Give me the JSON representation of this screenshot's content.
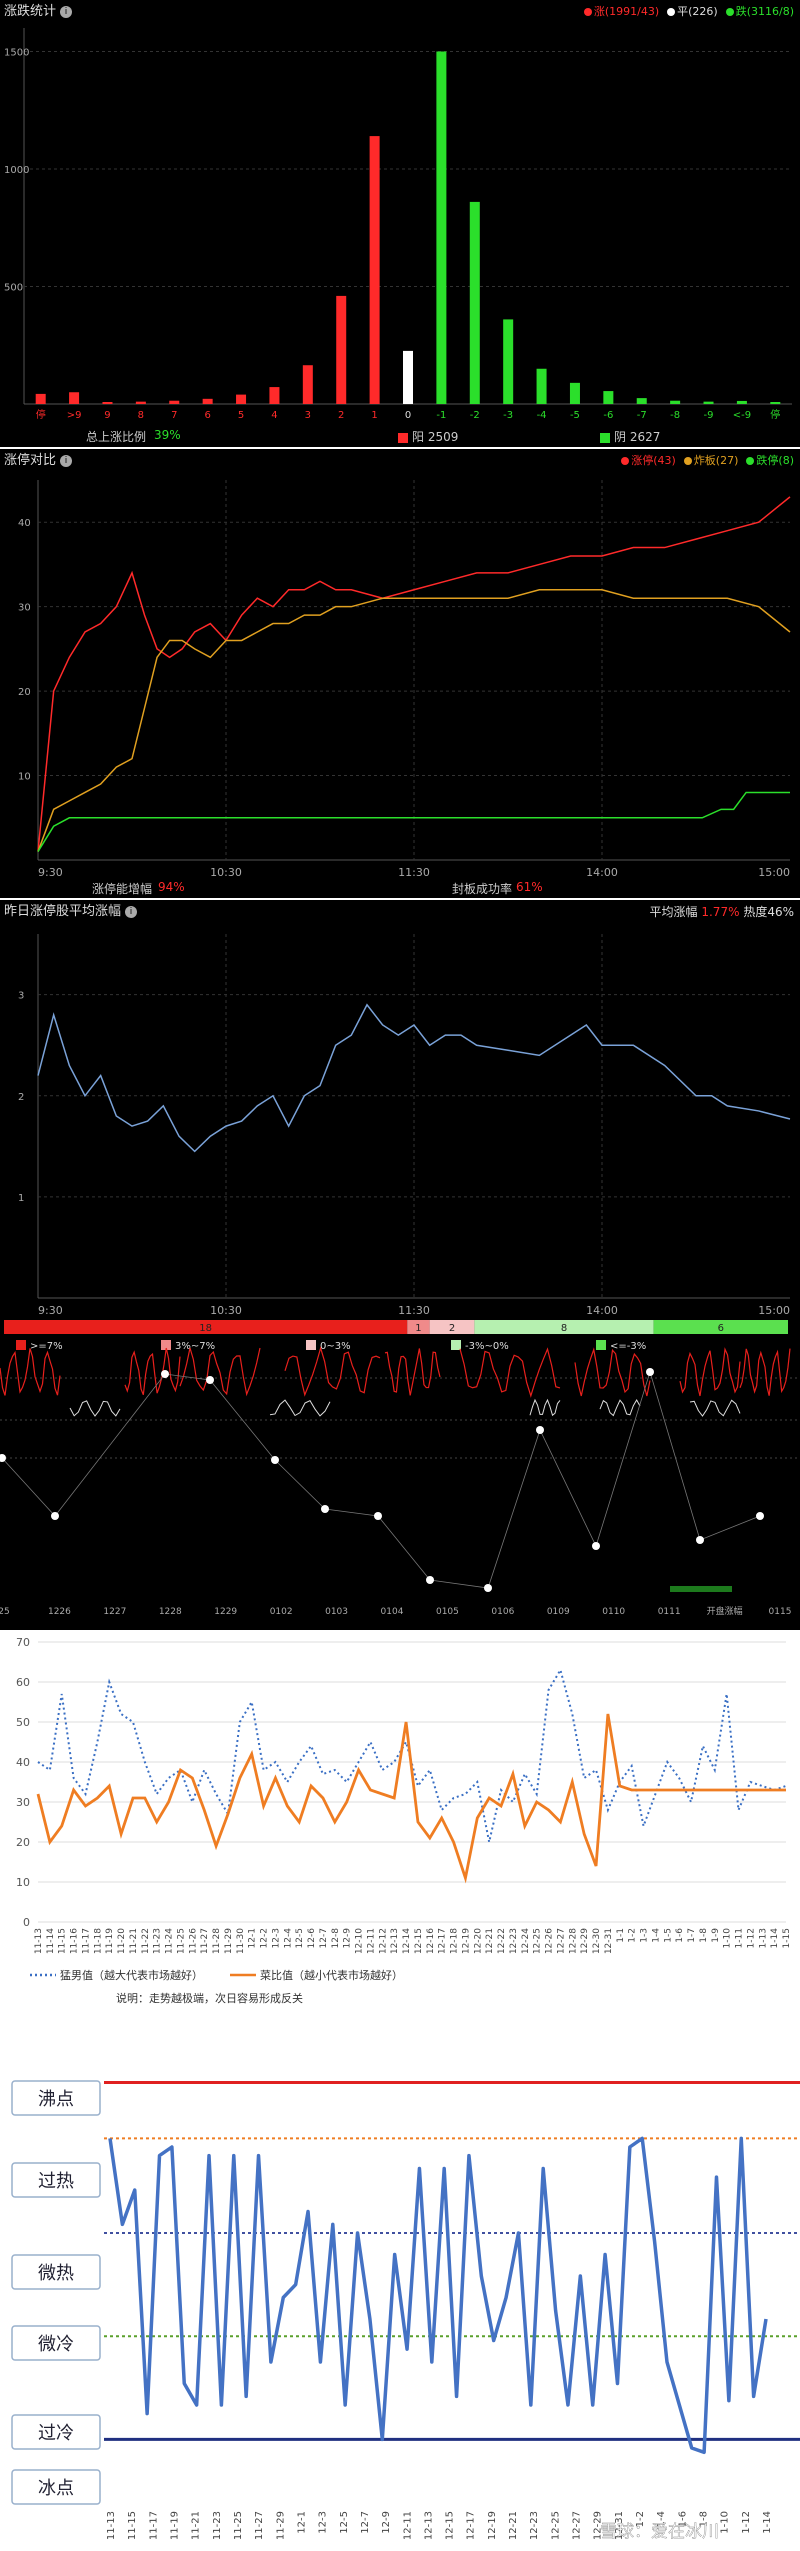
{
  "panel1": {
    "title": "涨跌统计",
    "legend": [
      {
        "label": "涨(1991/43)",
        "color": "#ff2a2a"
      },
      {
        "label": "平(226)",
        "color": "#ffffff"
      },
      {
        "label": "跌(3116/8)",
        "color": "#2bdf2b"
      }
    ],
    "footer": {
      "ratio_label": "总上涨比例",
      "ratio_value": "39%",
      "up_label": "阳 2509",
      "down_label": "阴 2627"
    }
  },
  "panel2": {
    "title": "涨停对比",
    "legend": [
      {
        "label": "涨停(43)",
        "color": "#ff2a2a"
      },
      {
        "label": "炸板(27)",
        "color": "#e0a020"
      },
      {
        "label": "跌停(8)",
        "color": "#2bdf2b"
      }
    ],
    "footer": {
      "a_label": "涨停能增幅",
      "a_value": "94%",
      "b_label": "封板成功率",
      "b_value": "61%"
    }
  },
  "panel3": {
    "title": "昨日涨停股平均涨幅",
    "right_label": "平均涨幅",
    "right_value": "1.77%",
    "heat_label": "热度46%"
  },
  "panel4": {
    "bar_segments": [
      {
        "label": "18",
        "value": 18,
        "color": "#e8201c"
      },
      {
        "label": "1",
        "value": 1,
        "color": "#f08a8a"
      },
      {
        "label": "2",
        "value": 2,
        "color": "#f6c4c4"
      },
      {
        "label": "8",
        "value": 8,
        "color": "#b6f0b0"
      },
      {
        "label": "6",
        "value": 6,
        "color": "#5be04f"
      }
    ],
    "legend": [
      {
        "label": ">=7%",
        "color": "#e8201c"
      },
      {
        "label": "3%~7%",
        "color": "#f08a8a"
      },
      {
        "label": "0~3%",
        "color": "#f6c4c4"
      },
      {
        "label": "-3%~0%",
        "color": "#b6f0b0"
      },
      {
        "label": "<=-3%",
        "color": "#5be04f"
      }
    ],
    "dates": [
      "25",
      "1226",
      "1227",
      "1228",
      "1229",
      "0102",
      "0103",
      "0104",
      "0105",
      "0106",
      "0109",
      "0110",
      "0111",
      "开盘涨幅",
      "0115"
    ]
  },
  "chart_data": [
    {
      "type": "bar",
      "categories": [
        "停",
        ">9",
        "9",
        "8",
        "7",
        "6",
        "5",
        "4",
        "3",
        "2",
        "1",
        "0",
        "-1",
        "-2",
        "-3",
        "-4",
        "-5",
        "-6",
        "-7",
        "-8",
        "-9",
        "<-9",
        "停"
      ],
      "values": [
        43,
        50,
        8,
        10,
        14,
        22,
        40,
        72,
        165,
        460,
        1140,
        226,
        1500,
        860,
        360,
        150,
        90,
        55,
        25,
        14,
        10,
        13,
        8
      ],
      "ylim": [
        0,
        1600
      ],
      "yticks": [
        "500",
        "1000",
        "1500"
      ],
      "colors": {
        "up": "#ff2a2a",
        "flat": "#ffffff",
        "down": "#2bdf2b"
      }
    },
    {
      "type": "line",
      "xticks": [
        "9:30",
        "10:30",
        "11:30",
        "14:00",
        "15:00"
      ],
      "yticks": [
        "10",
        "20",
        "30",
        "40"
      ],
      "ylim": [
        0,
        45
      ],
      "series": [
        {
          "name": "涨停",
          "color": "#ff2a2a",
          "x": [
            0,
            5,
            10,
            15,
            20,
            25,
            30,
            34,
            38,
            42,
            46,
            50,
            55,
            60,
            65,
            70,
            75,
            80,
            85,
            90,
            95,
            100,
            110,
            120,
            130,
            140,
            150,
            160,
            170,
            180,
            190,
            200,
            210,
            220,
            230,
            240
          ],
          "values": [
            1,
            20,
            24,
            27,
            28,
            30,
            34,
            29,
            25,
            24,
            25,
            27,
            28,
            26,
            29,
            31,
            30,
            32,
            32,
            33,
            32,
            32,
            31,
            32,
            33,
            34,
            34,
            35,
            36,
            36,
            37,
            37,
            38,
            39,
            40,
            43
          ]
        },
        {
          "name": "炸板",
          "color": "#e0a020",
          "x": [
            0,
            5,
            10,
            15,
            20,
            25,
            30,
            34,
            38,
            42,
            46,
            50,
            55,
            60,
            65,
            70,
            75,
            80,
            85,
            90,
            95,
            100,
            110,
            120,
            130,
            140,
            150,
            160,
            170,
            180,
            190,
            200,
            210,
            220,
            230,
            240
          ],
          "values": [
            1,
            6,
            7,
            8,
            9,
            11,
            12,
            18,
            24,
            26,
            26,
            25,
            24,
            26,
            26,
            27,
            28,
            28,
            29,
            29,
            30,
            30,
            31,
            31,
            31,
            31,
            31,
            32,
            32,
            32,
            31,
            31,
            31,
            31,
            30,
            27
          ]
        },
        {
          "name": "跌停",
          "color": "#2bdf2b",
          "x": [
            0,
            5,
            10,
            15,
            20,
            30,
            60,
            100,
            140,
            180,
            200,
            212,
            218,
            222,
            226,
            240
          ],
          "values": [
            1,
            4,
            5,
            5,
            5,
            5,
            5,
            5,
            5,
            5,
            5,
            5,
            6,
            6,
            8,
            8
          ]
        }
      ]
    },
    {
      "type": "line",
      "xticks": [
        "9:30",
        "10:30",
        "11:30",
        "14:00",
        "15:00"
      ],
      "yticks": [
        "1",
        "2",
        "3"
      ],
      "ylim": [
        0,
        3.6
      ],
      "series": [
        {
          "name": "平均涨幅",
          "color": "#7aa2d8",
          "x": [
            0,
            5,
            10,
            15,
            20,
            25,
            30,
            35,
            40,
            45,
            50,
            55,
            60,
            65,
            70,
            75,
            80,
            85,
            90,
            95,
            100,
            105,
            110,
            115,
            120,
            125,
            130,
            135,
            140,
            150,
            160,
            170,
            175,
            180,
            190,
            200,
            210,
            215,
            220,
            230,
            240
          ],
          "values": [
            2.2,
            2.8,
            2.3,
            2.0,
            2.2,
            1.8,
            1.7,
            1.75,
            1.9,
            1.6,
            1.45,
            1.6,
            1.7,
            1.75,
            1.9,
            2.0,
            1.7,
            2.0,
            2.1,
            2.5,
            2.6,
            2.9,
            2.7,
            2.6,
            2.7,
            2.5,
            2.6,
            2.6,
            2.5,
            2.45,
            2.4,
            2.6,
            2.7,
            2.5,
            2.5,
            2.3,
            2.0,
            2.0,
            1.9,
            1.85,
            1.77
          ]
        }
      ]
    },
    {
      "type": "line",
      "xticks": [
        "11-13",
        "11-14",
        "11-15",
        "11-16",
        "11-17",
        "11-18",
        "11-19",
        "11-20",
        "11-21",
        "11-22",
        "11-23",
        "11-24",
        "11-25",
        "11-26",
        "11-27",
        "11-28",
        "11-29",
        "11-30",
        "12-1",
        "12-2",
        "12-3",
        "12-4",
        "12-5",
        "12-6",
        "12-7",
        "12-8",
        "12-9",
        "12-10",
        "12-11",
        "12-12",
        "12-13",
        "12-14",
        "12-15",
        "12-16",
        "12-17",
        "12-18",
        "12-19",
        "12-20",
        "12-21",
        "12-22",
        "12-23",
        "12-24",
        "12-25",
        "12-26",
        "12-27",
        "12-28",
        "12-29",
        "12-30",
        "12-31",
        "1-1",
        "1-2",
        "1-3",
        "1-4",
        "1-5",
        "1-6",
        "1-7",
        "1-8",
        "1-9",
        "1-10",
        "1-11",
        "1-12",
        "1-13",
        "1-14",
        "1-15"
      ],
      "xticks_shown": [
        "11-13",
        "11-14",
        "11-15",
        "11-16",
        "11-17",
        "11-18",
        "11-19",
        "11-20",
        "11-21",
        "11-22",
        "11-23",
        "11-24",
        "11-25",
        "11-26",
        "11-27",
        "11-28",
        "11-29",
        "11-30",
        "12-1",
        "12-2",
        "12-3",
        "12-4",
        "12-5",
        "12-6",
        "12-7",
        "12-8",
        "12-9",
        "12-10",
        "12-11",
        "12-12",
        "12-13",
        "12-14",
        "12-15",
        "12-16",
        "12-17",
        "12-18",
        "12-19",
        "12-20",
        "12-21",
        "12-22",
        "12-23",
        "12-24",
        "12-25",
        "12-26",
        "12-27",
        "12-28",
        "12-29",
        "12-30",
        "12-31",
        "1-1",
        "1-2",
        "1-3",
        "1-4",
        "1-5",
        "1-6",
        "1-7",
        "1-8",
        "1-9",
        "1-10",
        "1-11",
        "1-12",
        "1-13",
        "1-14",
        "1-15"
      ],
      "yticks": [
        "0",
        "10",
        "20",
        "30",
        "40",
        "50",
        "60",
        "70"
      ],
      "ylim": [
        0,
        70
      ],
      "series": [
        {
          "name": "猛男值（越大代表市场越好）",
          "color": "#3a6fc4",
          "dashed": true,
          "values": [
            40,
            38,
            57,
            36,
            32,
            45,
            60,
            52,
            50,
            40,
            32,
            36,
            38,
            30,
            38,
            32,
            27,
            50,
            55,
            38,
            40,
            35,
            40,
            44,
            37,
            38,
            35,
            40,
            45,
            38,
            40,
            45,
            34,
            38,
            28,
            31,
            32,
            35,
            20,
            33,
            30,
            37,
            32,
            58,
            63,
            52,
            36,
            38,
            28,
            35,
            39,
            24,
            32,
            40,
            36,
            30,
            44,
            38,
            57,
            28,
            35,
            34,
            33,
            34
          ]
        },
        {
          "name": "菜比值（越小代表市场越好）",
          "color": "#ef7d22",
          "dashed": false,
          "values": [
            32,
            20,
            24,
            33,
            29,
            31,
            34,
            22,
            31,
            31,
            25,
            30,
            38,
            36,
            28,
            19,
            27,
            36,
            42,
            29,
            36,
            29,
            25,
            34,
            31,
            25,
            30,
            38,
            33,
            32,
            31,
            50,
            25,
            21,
            26,
            20,
            11,
            26,
            31,
            29,
            37,
            24,
            30,
            28,
            25,
            35,
            22,
            14,
            52,
            34,
            33,
            33,
            33,
            33,
            33,
            33,
            33,
            33,
            33,
            33,
            33,
            33,
            33,
            33
          ]
        }
      ],
      "note": "说明：走势越极端，次日容易形成反关"
    },
    {
      "type": "line",
      "xticks": [
        "11-13",
        "11-15",
        "11-17",
        "11-19",
        "11-21",
        "11-23",
        "11-25",
        "11-27",
        "11-29",
        "12-1",
        "12-3",
        "12-5",
        "12-7",
        "12-9",
        "12-11",
        "12-13",
        "12-15",
        "12-17",
        "12-19",
        "12-21",
        "12-23",
        "12-25",
        "12-27",
        "12-29",
        "12-31",
        "1-2",
        "1-4",
        "1-6",
        "1-8",
        "1-10",
        "1-12",
        "1-14"
      ],
      "zones": [
        "沸点",
        "过热",
        "微热",
        "微冷",
        "过冷",
        "冰点"
      ],
      "ylim": [
        0,
        100
      ],
      "series": [
        {
          "name": "情绪",
          "color": "#4472c4",
          "values": [
            82,
            62,
            70,
            18,
            78,
            80,
            25,
            20,
            78,
            20,
            78,
            22,
            78,
            30,
            45,
            48,
            65,
            30,
            62,
            20,
            60,
            40,
            12,
            55,
            33,
            75,
            30,
            75,
            22,
            78,
            50,
            35,
            45,
            60,
            20,
            75,
            42,
            20,
            50,
            20,
            55,
            25,
            80,
            82,
            58,
            30,
            20,
            10,
            9,
            73,
            21,
            82,
            22,
            40
          ]
        }
      ],
      "lines": [
        {
          "name": "沸点线",
          "value": 95,
          "color": "#e02020"
        },
        {
          "name": "过热线",
          "value": 82,
          "color": "#ef7d22"
        },
        {
          "name": "中线",
          "value": 60,
          "color": "#4050a0"
        },
        {
          "name": "过冷线",
          "value": 36,
          "color": "#5aa02c"
        },
        {
          "name": "冰点线",
          "value": 12,
          "color": "#203080"
        }
      ]
    }
  ],
  "watermark": "雪球：爱在冰川"
}
